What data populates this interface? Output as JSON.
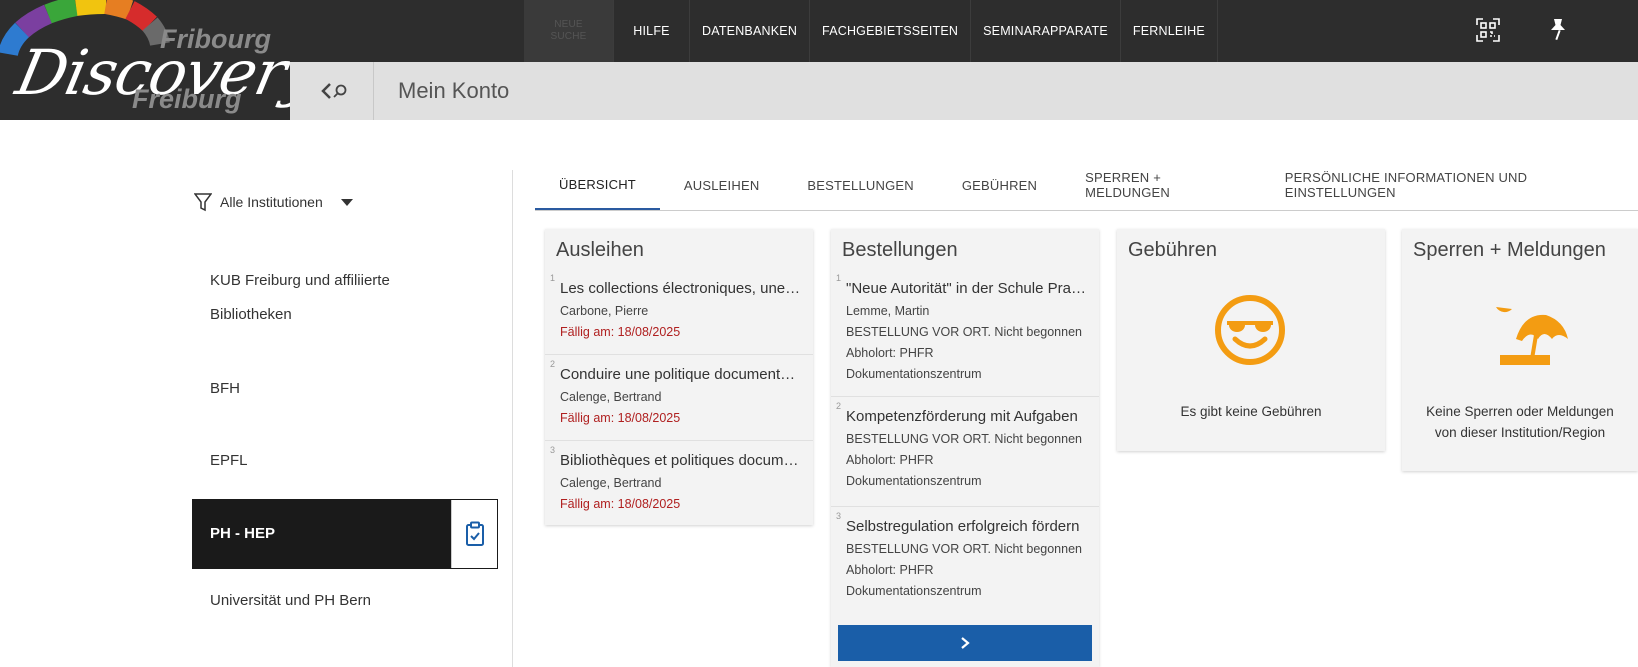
{
  "logo": {
    "line1": "Fribourg",
    "script": "Discovery",
    "line2": "Freiburg"
  },
  "nav": {
    "dim_item": "NEUE SUCHE",
    "items": [
      "HILFE",
      "DATENBANKEN",
      "FACHGEBIETSSEITEN",
      "SEMINARAPPARATE",
      "FERNLEIHE"
    ]
  },
  "top_icons": [
    "qr-code-icon",
    "pin-icon"
  ],
  "strip": {
    "title": "Mein Konto"
  },
  "filter": {
    "label": "Alle Institutionen"
  },
  "institutions": [
    "KUB Freiburg und affiliierte",
    "Bibliotheken",
    "BFH",
    "EPFL",
    "PH - HEP",
    "Universität und PH Bern"
  ],
  "tabs": [
    "ÜBERSICHT",
    "AUSLEIHEN",
    "BESTELLUNGEN",
    "GEBÜHREN",
    "SPERREN + MELDUNGEN",
    "PERSÖNLICHE INFORMATIONEN UND EINSTELLUNGEN"
  ],
  "loans": {
    "title": "Ausleihen",
    "items": [
      {
        "num": "1",
        "title": "Les collections électroniques, une ...",
        "author": "Carbone, Pierre",
        "due": "Fällig am: 18/08/2025"
      },
      {
        "num": "2",
        "title": "Conduire une politique documentaire",
        "author": "Calenge, Bertrand",
        "due": "Fällig am: 18/08/2025"
      },
      {
        "num": "3",
        "title": "Bibliothèques et politiques documentaires",
        "author": "Calenge, Bertrand",
        "due": "Fällig am: 18/08/2025"
      }
    ]
  },
  "requests": {
    "title": "Bestellungen",
    "items": [
      {
        "num": "1",
        "title": "\"Neue Autorität\" in der Schule Praxis",
        "author": "Lemme, Martin",
        "status": "BESTELLUNG VOR ORT. Nicht begonnen",
        "pickup1": "Abholort: PHFR",
        "pickup2": "Dokumentationszentrum"
      },
      {
        "num": "2",
        "title": "Kompetenzförderung mit Aufgaben",
        "author": "",
        "status": "BESTELLUNG VOR ORT. Nicht begonnen",
        "pickup1": "Abholort: PHFR",
        "pickup2": "Dokumentationszentrum"
      },
      {
        "num": "3",
        "title": "Selbstregulation erfolgreich fördern",
        "author": "",
        "status": "BESTELLUNG VOR ORT. Nicht begonnen",
        "pickup1": "Abholort: PHFR",
        "pickup2": "Dokumentationszentrum"
      }
    ]
  },
  "fees": {
    "title": "Gebühren",
    "empty": "Es gibt keine Gebühren"
  },
  "blocks": {
    "title": "Sperren + Meldungen",
    "empty1": "Keine Sperren oder Meldungen",
    "empty2": "von dieser Institution/Region"
  },
  "colors": {
    "accent": "#f39c12",
    "due": "#b02020",
    "button": "#1a5ea8"
  }
}
